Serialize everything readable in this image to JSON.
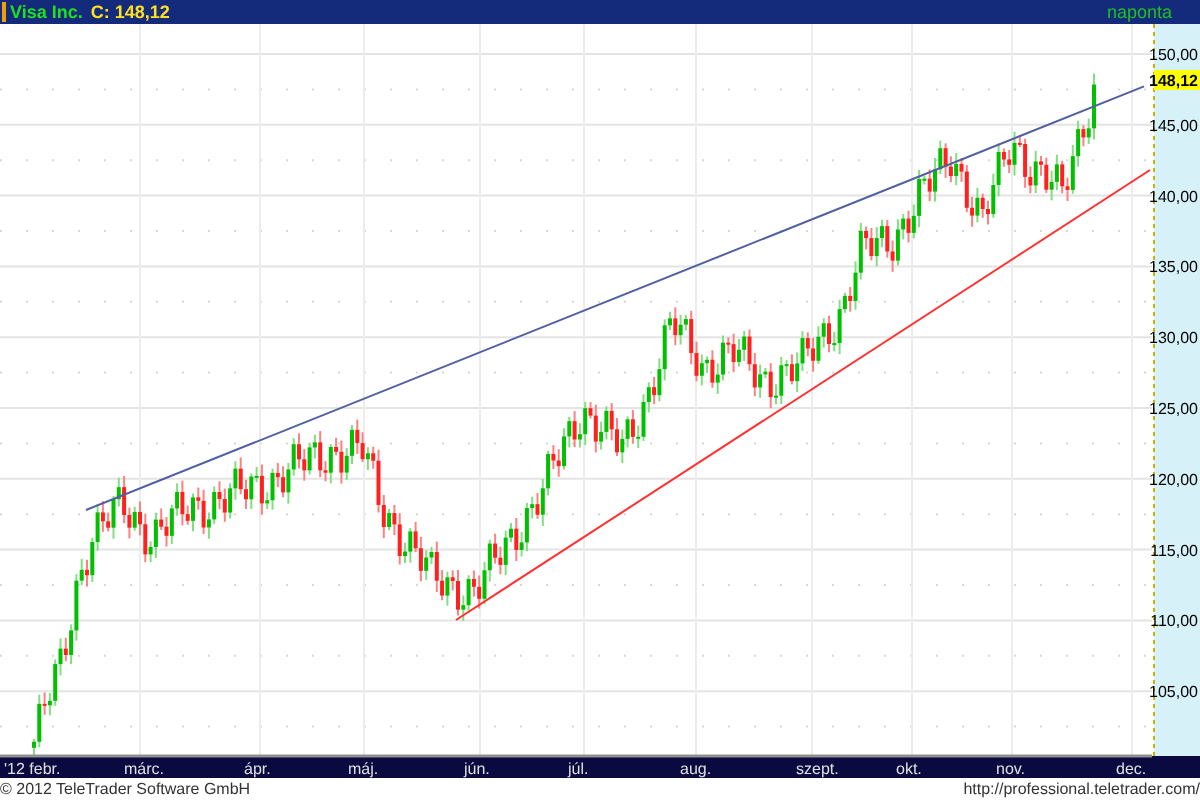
{
  "header": {
    "symbol": "Visa Inc.",
    "close": "C: 148,12",
    "interval": "naponta"
  },
  "chart": {
    "price_badge": "148,12",
    "y_labels": [
      "150,00",
      "145,00",
      "140,00",
      "135,00",
      "130,00",
      "125,00",
      "120,00",
      "115,00",
      "110,00",
      "105,00"
    ],
    "x_labels": [
      "'12 febr.",
      "márc.",
      "ápr.",
      "máj.",
      "jún.",
      "júl.",
      "aug.",
      "szept.",
      "okt.",
      "nov.",
      "dec."
    ]
  },
  "footer": {
    "copyright": "© 2012 TeleTrader Software GmbH",
    "url": "http://professional.teletrader.com/"
  }
}
